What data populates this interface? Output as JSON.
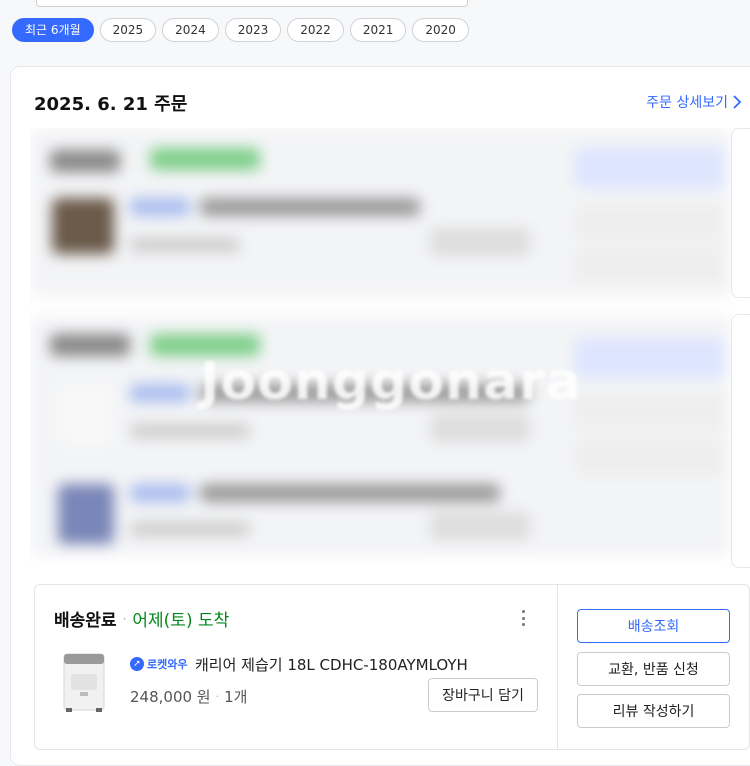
{
  "filters": [
    "최근 6개월",
    "2025",
    "2024",
    "2023",
    "2022",
    "2021",
    "2020"
  ],
  "order": {
    "date": "2025. 6. 21 주문",
    "detail_link": "주문 상세보기"
  },
  "watermark": "Joonggonara",
  "item": {
    "status_done": "배송완료",
    "status_sep": "·",
    "status_arrival": "어제(토) 도착",
    "badge": "로켓와우",
    "name": "캐리어 제습기 18L CDHC-180AYMLOYH",
    "price": "248,000 원",
    "qty_sep": "·",
    "quantity": "1개",
    "cart_button": "장바구니 담기"
  },
  "side_buttons": [
    "배송조회",
    "교환, 반품 신청",
    "리뷰 작성하기"
  ],
  "colors": {
    "accent": "#346aff",
    "arrival": "#00891a"
  }
}
